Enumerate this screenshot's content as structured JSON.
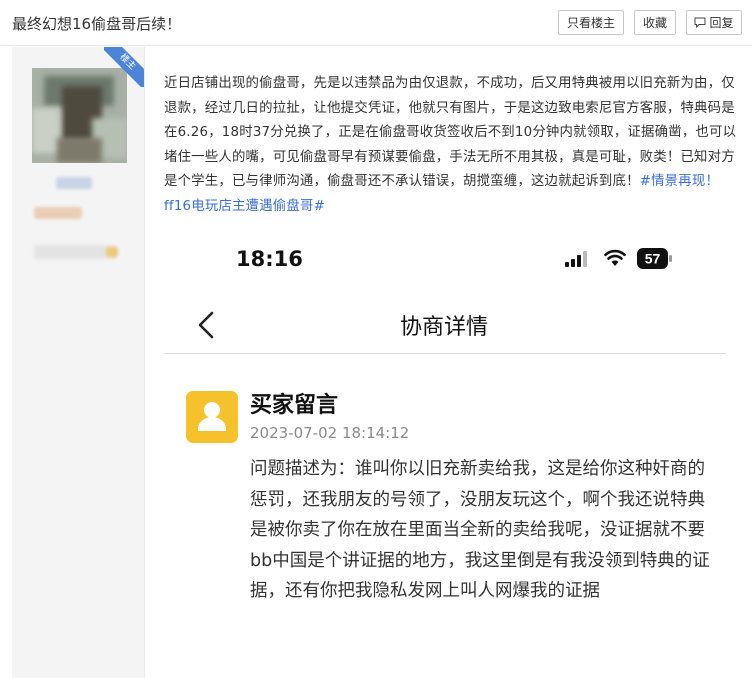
{
  "thread": {
    "title": "最终幻想16偷盘哥后续！"
  },
  "toolbar": {
    "only_op_label": "只看楼主",
    "favorite_label": "收藏",
    "reply_label": "回复"
  },
  "author": {
    "badge": "楼主"
  },
  "post": {
    "text": "近日店铺出现的偷盘哥，先是以违禁品为由仅退款，不成功，后又用特典被用以旧充新为由，仅退款，经过几日的拉扯，让他提交凭证，他就只有图片，于是这边致电索尼官方客服，特典码是在6.26，18时37分兑换了，正是在偷盘哥收货签收后不到10分钟内就领取，证据确凿，也可以堵住一些人的嘴，可见偷盘哥早有预谋要偷盘，手法无所不用其极，真是可耻，败类！已知对方是个学生，已与律师沟通，偷盘哥还不承认错误，胡搅蛮缠，这边就起诉到底！",
    "tag1": "#情景再现！",
    "tag2": "ff16电玩店主遭遇偷盘哥#"
  },
  "screenshot": {
    "time": "18:16",
    "battery": "57",
    "nav_title": "协商详情",
    "msg_title": "买家留言",
    "msg_time": "2023-07-02 18:14:12",
    "msg_text": "问题描述为：谁叫你以旧充新卖给我，这是给你这种奸商的惩罚，还我朋友的号领了，没朋友玩这个，啊个我还说特典是被你卖了你在放在里面当全新的卖给我呢，没证据就不要bb中国是个讲证据的地方，我这里倒是有我没领到特典的证据，还有你把我隐私发网上叫人网爆我的证据"
  },
  "colors": {
    "link": "#3a6fcf",
    "badge": "#4c84d9",
    "buyer_avatar": "#f5c12c",
    "sidebar": "#f4f4f4"
  }
}
